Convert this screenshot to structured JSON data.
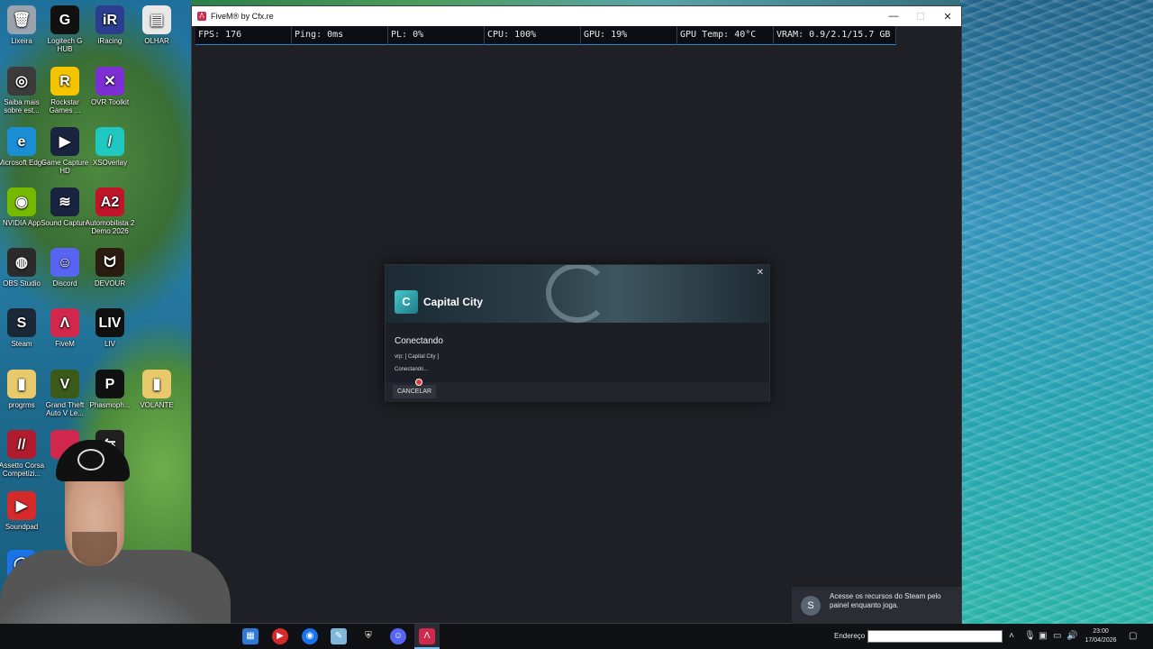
{
  "desktop": {
    "icons": [
      {
        "label": "Lixeira",
        "color": "#9aa4ae",
        "glyph": "🗑"
      },
      {
        "label": "Logitech G HUB",
        "color": "#111111",
        "glyph": "G"
      },
      {
        "label": "iRacing",
        "color": "#2a3d8f",
        "glyph": "iR"
      },
      {
        "label": "OLHAR",
        "color": "#e8e8e8",
        "glyph": "▤"
      },
      {
        "label": "Saiba mais sobre est...",
        "color": "#3b3b3b",
        "glyph": "◎"
      },
      {
        "label": "Rockstar Games ...",
        "color": "#f5c400",
        "glyph": "R"
      },
      {
        "label": "OVR Toolkit",
        "color": "#7d2fd6",
        "glyph": "✕"
      },
      {
        "label": "Microsoft Edge",
        "color": "#1b8fd6",
        "glyph": "e"
      },
      {
        "label": "Game Capture HD",
        "color": "#1a2340",
        "glyph": "▶"
      },
      {
        "label": "XSOverlay",
        "color": "#1fc9c1",
        "glyph": "/"
      },
      {
        "label": "NVIDIA App",
        "color": "#76b900",
        "glyph": "◉"
      },
      {
        "label": "Sound Capture",
        "color": "#1a2340",
        "glyph": "≋"
      },
      {
        "label": "Automobilista 2 Demo 2026",
        "color": "#c0142a",
        "glyph": "A2"
      },
      {
        "label": "OBS Studio",
        "color": "#2b2b2b",
        "glyph": "◍"
      },
      {
        "label": "Discord",
        "color": "#5865f2",
        "glyph": "☺"
      },
      {
        "label": "DEVOUR",
        "color": "#2b1b10",
        "glyph": "ᗢ"
      },
      {
        "label": "Steam",
        "color": "#1b2838",
        "glyph": "S"
      },
      {
        "label": "FiveM",
        "color": "#d0284c",
        "glyph": "Λ"
      },
      {
        "label": "LIV",
        "color": "#111111",
        "glyph": "LIV"
      },
      {
        "label": "progrms",
        "color": "#e8c96b",
        "glyph": "▮"
      },
      {
        "label": "Grand Theft Auto V Le...",
        "color": "#3a5a1a",
        "glyph": "V"
      },
      {
        "label": "Phasmoph...",
        "color": "#111111",
        "glyph": "P"
      },
      {
        "label": "VOLANTE",
        "color": "#e8c96b",
        "glyph": "▮"
      },
      {
        "label": "Assetto Corsa Competizi...",
        "color": "#b01c2e",
        "glyph": "//"
      },
      {
        "label": "",
        "color": "#d0284c",
        "glyph": ""
      },
      {
        "label": "",
        "color": "#202020",
        "glyph": "⇆"
      },
      {
        "label": "Soundpad",
        "color": "#d42a2a",
        "glyph": "▶"
      },
      {
        "label": "",
        "color": "#1a73e8",
        "glyph": "◯"
      }
    ]
  },
  "window": {
    "title": "FiveM® by Cfx.re",
    "minimize": "—",
    "maximize": "☐",
    "close": "✕"
  },
  "perf": {
    "fps": "FPS: 176",
    "ping": "Ping: 0ms",
    "pl": "PL: 0%",
    "cpu": "CPU: 100%",
    "gpu": "GPU: 19%",
    "gpu_temp": "GPU Temp: 40°C",
    "vram": "VRAM: 0.9/2.1/15.7 GB"
  },
  "dialog": {
    "server_name": "Capital City",
    "server_logo_glyph": "C",
    "heading": "Conectando",
    "line1": "vrp: [ Capital City ]",
    "line2": "Conectando...",
    "cancel_label": "CANCELAR",
    "close_glyph": "✕"
  },
  "toast": {
    "text": "Acesse os recursos do Steam pelo painel enquanto joga."
  },
  "taskbar": {
    "address_label": "Endereço",
    "address_value": "",
    "time": "23:00",
    "date": "17/04/2026"
  },
  "colors": {
    "perf_accent": "#1f86d4",
    "fivem_brand": "#d0284c",
    "dialog_bg": "#1d1f26"
  }
}
